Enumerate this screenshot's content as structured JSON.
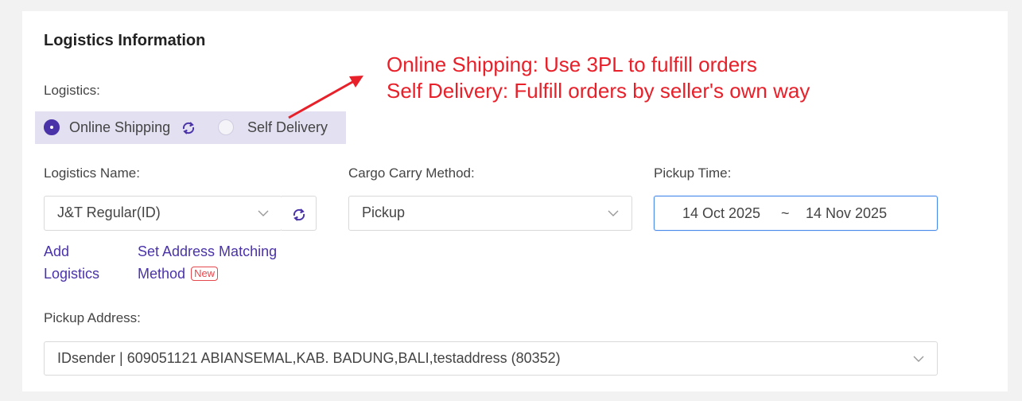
{
  "section": {
    "title": "Logistics Information"
  },
  "logistics": {
    "label": "Logistics:",
    "options": [
      {
        "label": "Online Shipping",
        "selected": true
      },
      {
        "label": "Self Delivery",
        "selected": false
      }
    ]
  },
  "logistics_name": {
    "label": "Logistics Name:",
    "value": "J&T Regular(ID)"
  },
  "cargo": {
    "label": "Cargo Carry Method:",
    "value": "Pickup"
  },
  "pickup_time": {
    "label": "Pickup Time:",
    "start": "14 Oct 2025",
    "separator": "~",
    "end": "14 Nov 2025"
  },
  "links": {
    "add_logistics_1": "Add",
    "add_logistics_2": "Logistics",
    "address_matching_1": "Set Address Matching",
    "address_matching_2": "Method",
    "new_badge": "New"
  },
  "pickup_address": {
    "label": "Pickup Address:",
    "value": "IDsender | 609051121 ABIANSEMAL,KAB. BADUNG,BALI,testaddress (80352)"
  },
  "annotation": {
    "line1": "Online Shipping: Use 3PL to fulfill orders",
    "line2": "Self Delivery: Fulfill orders by seller's own way"
  },
  "colors": {
    "accent": "#4a33a8",
    "annotation": "#e8202a",
    "focus": "#4a8ae8",
    "badge": "#e5484d"
  },
  "icons": [
    "sync-icon",
    "chevron-down-icon",
    "annotation-arrow"
  ]
}
